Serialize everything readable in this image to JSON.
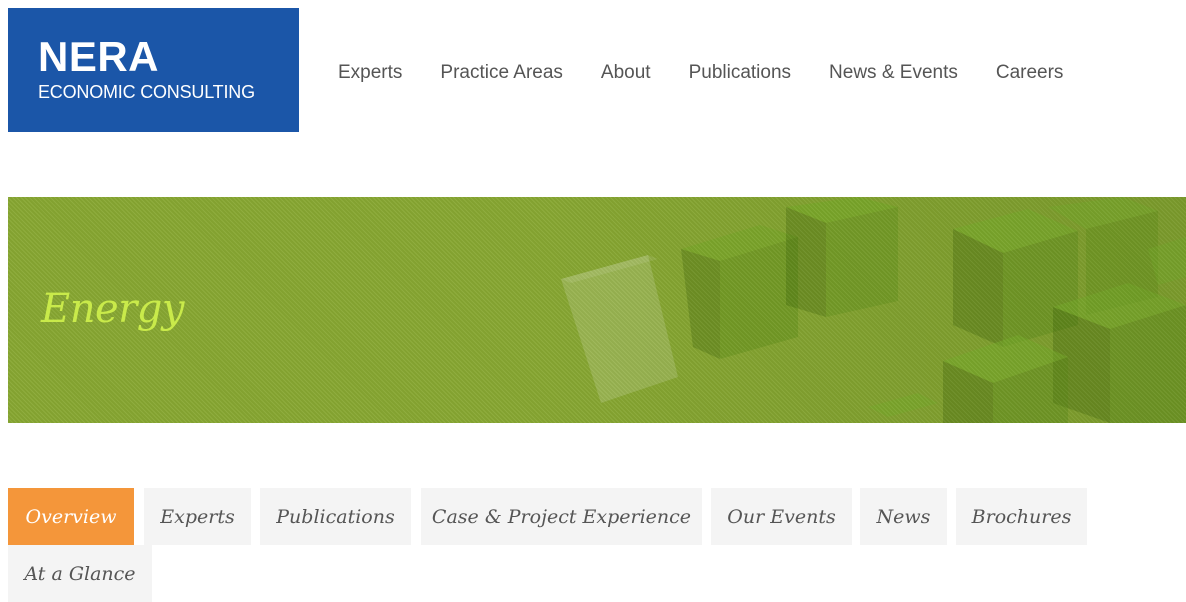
{
  "logo": {
    "title": "NERA",
    "subtitle": "ECONOMIC CONSULTING"
  },
  "nav": {
    "items": [
      {
        "label": "Experts"
      },
      {
        "label": "Practice Areas"
      },
      {
        "label": "About"
      },
      {
        "label": "Publications"
      },
      {
        "label": "News & Events"
      },
      {
        "label": "Careers"
      }
    ]
  },
  "banner": {
    "title": "Energy"
  },
  "tabs": {
    "active_index": 0,
    "items": [
      {
        "label": "Overview"
      },
      {
        "label": "Experts"
      },
      {
        "label": "Publications"
      },
      {
        "label": "Case & Project Experience"
      },
      {
        "label": "Our Events"
      },
      {
        "label": "News"
      },
      {
        "label": "Brochures"
      },
      {
        "label": "At a Glance"
      }
    ]
  },
  "colors": {
    "logo_bg": "#1b56a8",
    "banner_bg": "#88a832",
    "banner_title": "#c9ea4a",
    "tab_active_bg": "#f4963a",
    "tab_bg": "#f4f4f4"
  }
}
